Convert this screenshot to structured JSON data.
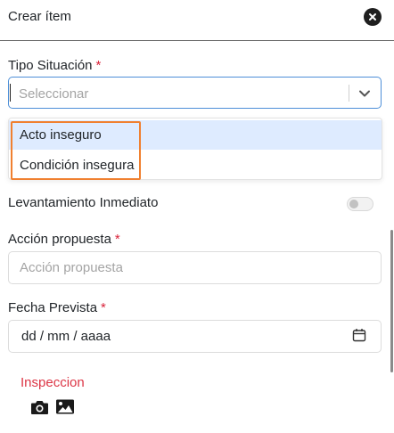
{
  "modal": {
    "title": "Crear ítem"
  },
  "tipo_situacion": {
    "label": "Tipo Situación",
    "required_mark": "*",
    "placeholder": "Seleccionar",
    "options": [
      "Acto inseguro",
      "Condición insegura"
    ],
    "highlighted_option": "Acto inseguro"
  },
  "levantamiento": {
    "label": "Levantamiento Inmediato",
    "enabled": false
  },
  "accion": {
    "label": "Acción propuesta",
    "required_mark": "*",
    "placeholder": "Acción propuesta",
    "value": ""
  },
  "fecha": {
    "label": "Fecha Prevista",
    "required_mark": "*",
    "value": "dd / mm / aaaa"
  },
  "inspeccion": {
    "label": "Inspeccion",
    "icons": [
      "camera-icon",
      "image-icon"
    ]
  },
  "colors": {
    "required": "#d9233a",
    "focus_border": "#4d8fd8",
    "option_hover": "#deebff",
    "annotation": "#f08030",
    "inspeccion_text": "#dc3545"
  }
}
